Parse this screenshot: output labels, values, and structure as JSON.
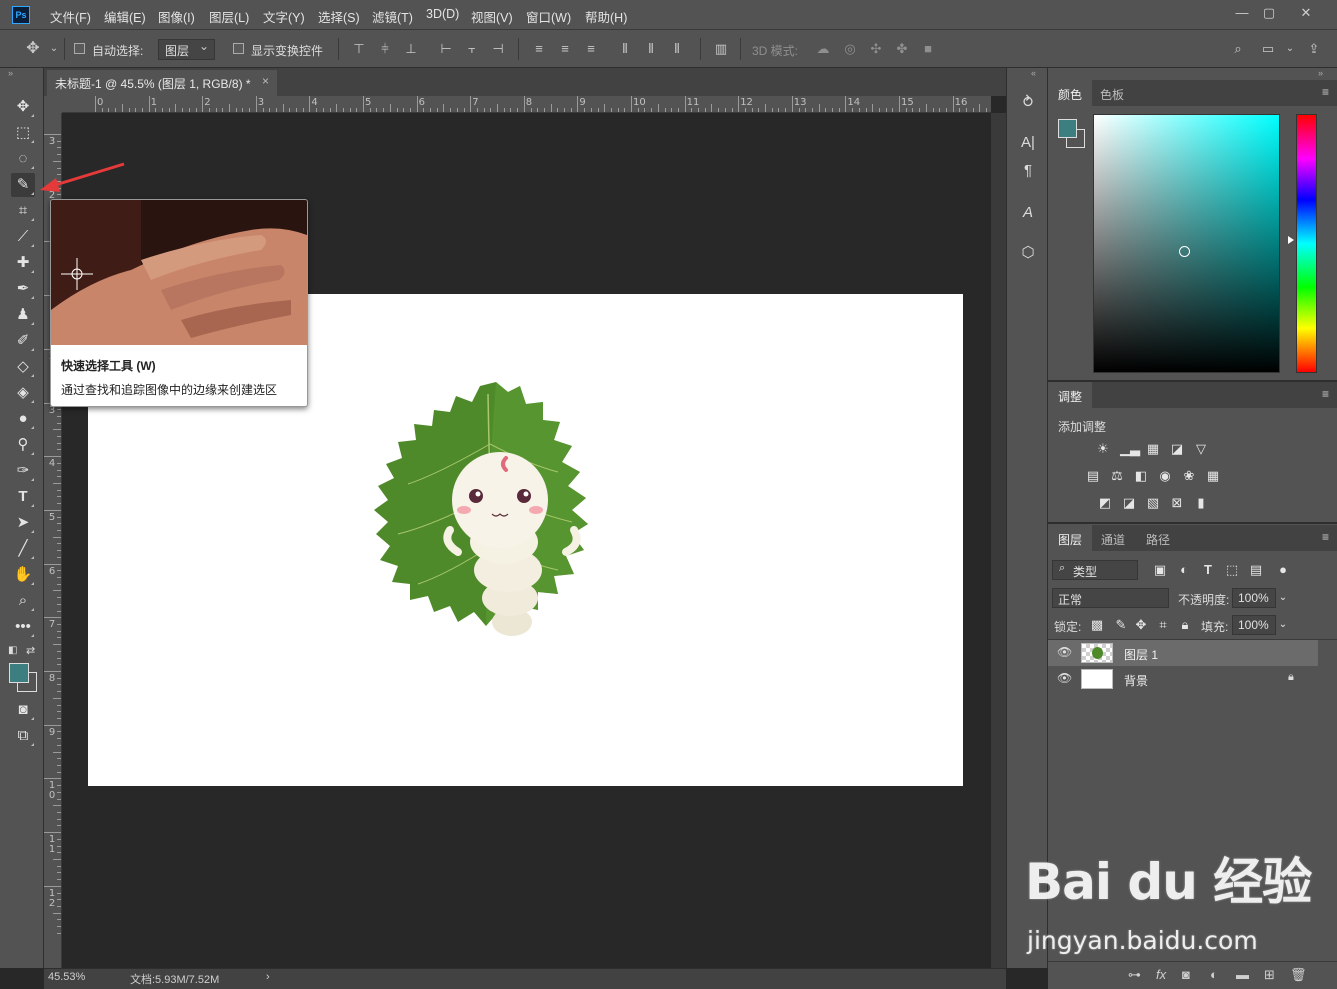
{
  "app": {
    "logo": "Ps",
    "menus": [
      "文件(F)",
      "编辑(E)",
      "图像(I)",
      "图层(L)",
      "文字(Y)",
      "选择(S)",
      "滤镜(T)",
      "3D(D)",
      "视图(V)",
      "窗口(W)",
      "帮助(H)"
    ],
    "window_controls": [
      "—",
      "▢",
      "✕"
    ]
  },
  "options": {
    "auto_select_label": "自动选择:",
    "auto_select_target": "图层",
    "show_transform_label": "显示变换控件",
    "mode_3d_label": "3D 模式:"
  },
  "document": {
    "tab_title": "未标题-1 @ 45.5% (图层 1, RGB/8) *",
    "close_glyph": "×",
    "ruler_h_labels": [
      "0",
      "1",
      "2",
      "3",
      "4",
      "5",
      "6",
      "7",
      "8",
      "9",
      "10",
      "11",
      "12",
      "13",
      "14",
      "15",
      "16"
    ],
    "ruler_v_labels": [
      "3",
      "2",
      "1",
      "1",
      "2",
      "3",
      "4",
      "5",
      "6",
      "7",
      "8",
      "9",
      "10",
      "11",
      "12"
    ]
  },
  "status": {
    "zoom": "45.53%",
    "doc_info": "文档:5.93M/7.52M",
    "arrow": "›"
  },
  "tooltip": {
    "title": "快速选择工具 (W)",
    "description": "通过查找和追踪图像中的边缘来创建选区"
  },
  "colors": {
    "foreground": "#3d7f80",
    "background": "#535353",
    "accent": "#31a8ff",
    "leaf_green": "#4f8a2a"
  },
  "panels": {
    "color_tabs": [
      "颜色",
      "色板"
    ],
    "adjust_tab": "调整",
    "adjust_add_label": "添加调整",
    "layer_tabs": [
      "图层",
      "通道",
      "路径"
    ],
    "filter_kind": "类型",
    "blend_mode": "正常",
    "opacity_label": "不透明度:",
    "opacity_value": "100%",
    "lock_label": "锁定:",
    "fill_label": "填充:",
    "fill_value": "100%",
    "layers": [
      {
        "name": "图层 1",
        "selected": true
      },
      {
        "name": "背景",
        "selected": false
      }
    ]
  },
  "watermark": {
    "logo": "Bai du 经验",
    "url": "jingyan.baidu.com"
  }
}
